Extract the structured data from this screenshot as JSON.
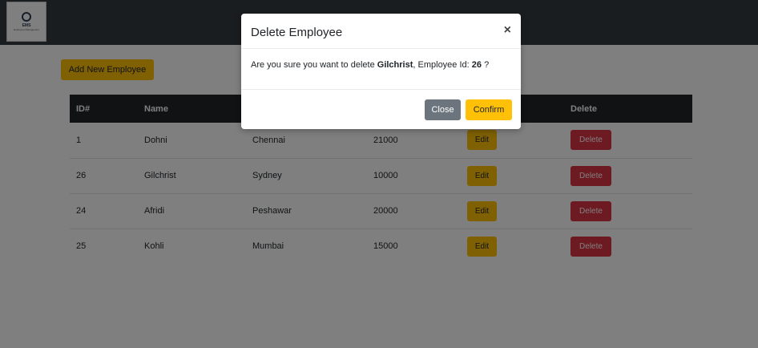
{
  "navbar": {
    "logo": {
      "title": "EMS",
      "subtitle": "Employee Management"
    }
  },
  "main": {
    "add_button_label": "Add New Employee",
    "table": {
      "headers": [
        "ID#",
        "Name",
        "",
        "",
        "",
        "Delete"
      ],
      "rows": [
        {
          "id": "1",
          "name": "Dohni",
          "city": "Chennai",
          "salary": "21000",
          "edit_label": "Edit",
          "delete_label": "Delete"
        },
        {
          "id": "26",
          "name": "Gilchrist",
          "city": "Sydney",
          "salary": "10000",
          "edit_label": "Edit",
          "delete_label": "Delete"
        },
        {
          "id": "24",
          "name": "Afridi",
          "city": "Peshawar",
          "salary": "20000",
          "edit_label": "Edit",
          "delete_label": "Delete"
        },
        {
          "id": "25",
          "name": "Kohli",
          "city": "Mumbai",
          "salary": "15000",
          "edit_label": "Edit",
          "delete_label": "Delete"
        }
      ]
    }
  },
  "modal": {
    "title": "Delete Employee",
    "close_symbol": "×",
    "message_prefix": "Are you sure you want to delete ",
    "employee_name": "Gilchrist",
    "message_middle": ", Employee Id: ",
    "employee_id": "26",
    "message_suffix": " ?",
    "close_label": "Close",
    "confirm_label": "Confirm"
  },
  "colors": {
    "navbar": "#343a40",
    "warning": "#ffc107",
    "danger": "#dc3545",
    "secondary": "#6c757d",
    "table_header": "#212529"
  }
}
